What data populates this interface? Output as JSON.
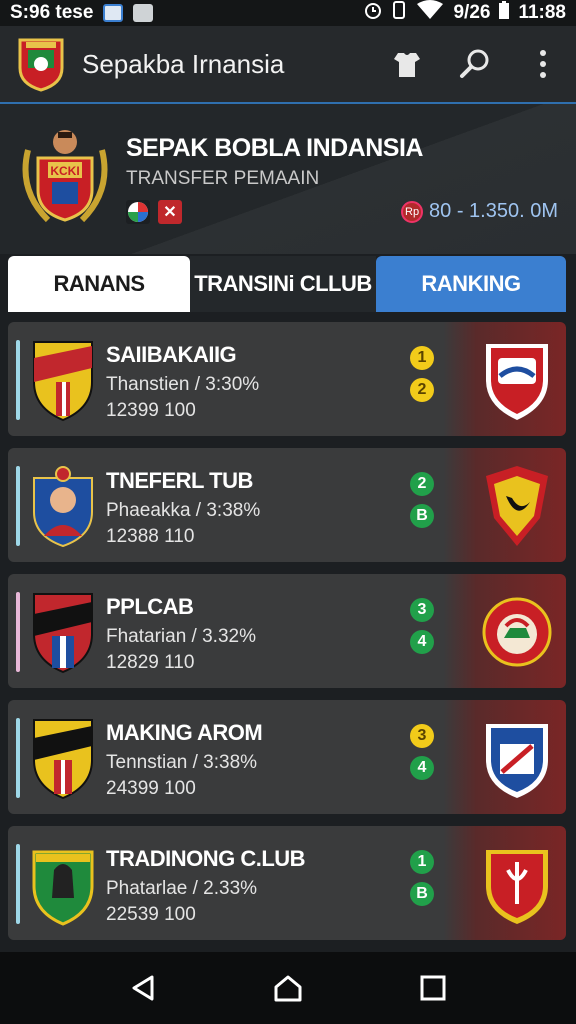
{
  "status_bar": {
    "time_left": "S:96 tese",
    "battery": "9/26",
    "time_right": "11:88"
  },
  "appbar": {
    "title": "Sepakba Irnansia",
    "icons": [
      "shirt-icon",
      "search-icon",
      "more-vert-icon"
    ]
  },
  "header": {
    "title": "SEPAK BOBLA INDANSIA",
    "subtitle": "TRANSFER PEMAAIN",
    "emblem_text": "KCKI",
    "price": "80 - 1.350. 0M",
    "coin_text": "Rp"
  },
  "tabs": [
    {
      "label": "RANANS"
    },
    {
      "label": "TRANSINi CLLUB"
    },
    {
      "label": "RANKING"
    }
  ],
  "rows": [
    {
      "name": "SAIIBAKAIIG",
      "sub": "Thanstien / 3:30%",
      "num": "12399 100",
      "badges": [
        "1",
        "2"
      ],
      "badge_colors": [
        "yellow",
        "yellow"
      ]
    },
    {
      "name": "TNEFERL TUB",
      "sub": "Phaeakka / 3:38%",
      "num": "12388 110",
      "badges": [
        "2",
        "B"
      ],
      "badge_colors": [
        "green",
        "green"
      ]
    },
    {
      "name": "PPLCAB",
      "sub": "Fhatarian / 3.32%",
      "num": "12829 110",
      "badges": [
        "3",
        "4"
      ],
      "badge_colors": [
        "green",
        "green"
      ]
    },
    {
      "name": "MAKING AROM",
      "sub": "Tennstian / 3:38%",
      "num": "24399 100",
      "badges": [
        "3",
        "4"
      ],
      "badge_colors": [
        "yellow",
        "green"
      ]
    },
    {
      "name": "TRADINONG C.LUB",
      "sub": "Phatarlae / 2.33%",
      "num": "22539 100",
      "badges": [
        "1",
        "B"
      ],
      "badge_colors": [
        "green",
        "green"
      ]
    }
  ],
  "nav": [
    "back-icon",
    "home-icon",
    "recents-icon"
  ],
  "colors": {
    "accent": "#3b7fd0",
    "badge_yellow": "#f2cb1a",
    "badge_green": "#21a04a"
  }
}
